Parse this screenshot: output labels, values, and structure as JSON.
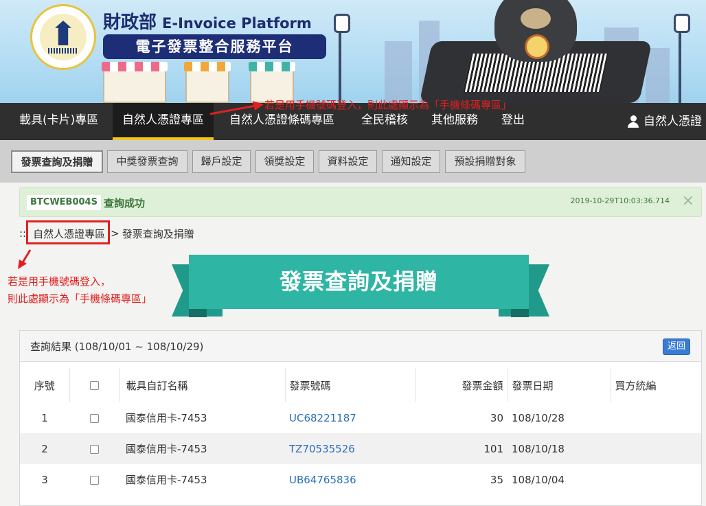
{
  "brand": {
    "ministry": "財政部",
    "platform_en": "E-Invoice Platform",
    "platform_zh": "電子發票整合服務平台"
  },
  "main_nav": {
    "items": [
      "載具(卡片)專區",
      "自然人憑證專區",
      "自然人憑證條碼專區",
      "全民稽核",
      "其他服務",
      "登出"
    ],
    "active": "自然人憑證專區",
    "user_label": "自然人憑證"
  },
  "sub_nav": {
    "tabs": [
      "發票查詢及捐贈",
      "中獎發票查詢",
      "歸戶設定",
      "領獎設定",
      "資料設定",
      "通知設定",
      "預設捐贈對象"
    ],
    "active": "發票查詢及捐贈"
  },
  "alert": {
    "code": "BTCWEB004S",
    "message": "查詢成功",
    "timestamp": "2019-10-29T10:03:36.714",
    "close": "×"
  },
  "breadcrumb": {
    "prefix": "::",
    "parent": "自然人憑證專區",
    "separator": ">",
    "current": "發票查詢及捐贈"
  },
  "annotations": {
    "top": "若是用手機號碼登入，則此處顯示為「手機條碼專區」",
    "left_line1": "若是用手機號碼登入，",
    "left_line2": "則此處顯示為「手機條碼專區」"
  },
  "page_title": "發票查詢及捐贈",
  "results": {
    "title": "查詢結果 (108/10/01 ~ 108/10/29)",
    "back_label": "返回",
    "columns": [
      "序號",
      "",
      "載具自訂名稱",
      "發票號碼",
      "發票金額",
      "發票日期",
      "買方統編"
    ],
    "rows": [
      {
        "no": "1",
        "name": "國泰信用卡-7453",
        "invoice": "UC68221187",
        "amount": "30",
        "date": "108/10/28",
        "buyer": ""
      },
      {
        "no": "2",
        "name": "國泰信用卡-7453",
        "invoice": "TZ70535526",
        "amount": "101",
        "date": "108/10/18",
        "buyer": ""
      },
      {
        "no": "3",
        "name": "國泰信用卡-7453",
        "invoice": "UB64765836",
        "amount": "35",
        "date": "108/10/04",
        "buyer": ""
      }
    ]
  },
  "colors": {
    "accent_teal": "#2eb5a3",
    "nav_dark": "#2f2f2f",
    "active_underline": "#f5c518",
    "annotation_red": "#e02020",
    "success_green": "#3c763d",
    "link_blue": "#2a6ebb"
  },
  "icons": {
    "user": "user-icon",
    "close": "close-icon",
    "arrow": "red-arrow-icon"
  }
}
